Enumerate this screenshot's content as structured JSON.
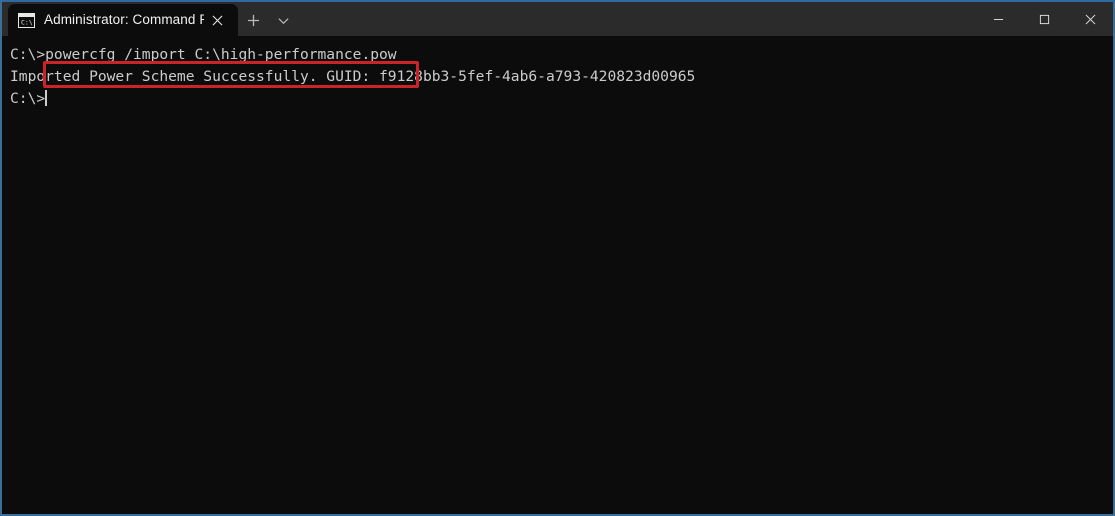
{
  "window": {
    "accent_color": "#2d6a9f",
    "titlebar_color": "#2b2b2b",
    "terminal_bg": "#0c0c0c",
    "terminal_fg": "#cccccc",
    "tab": {
      "icon": "command-prompt-icon",
      "title": "Administrator: Command Promp",
      "close_label": "Close tab"
    },
    "new_tab_label": "New tab",
    "tab_dropdown_label": "Open new tab dropdown",
    "controls": {
      "minimize": "Minimize",
      "maximize": "Maximize",
      "close": "Close"
    }
  },
  "terminal": {
    "lines": [
      "C:\\>powercfg /import C:\\high-performance.pow",
      "Imported Power Scheme Successfully. GUID: f9128bb3-5fef-4ab6-a793-420823d00965",
      "C:\\>"
    ],
    "prompt": "C:\\>",
    "command": "powercfg /import C:\\high-performance.pow",
    "output": "Imported Power Scheme Successfully. GUID: f9128bb3-5fef-4ab6-a793-420823d00965",
    "guid": "f9128bb3-5fef-4ab6-a793-420823d00965"
  },
  "annotation": {
    "highlight_color": "#cc2229",
    "highlight_target": "powercfg /import C:\\high-performance.pow"
  }
}
